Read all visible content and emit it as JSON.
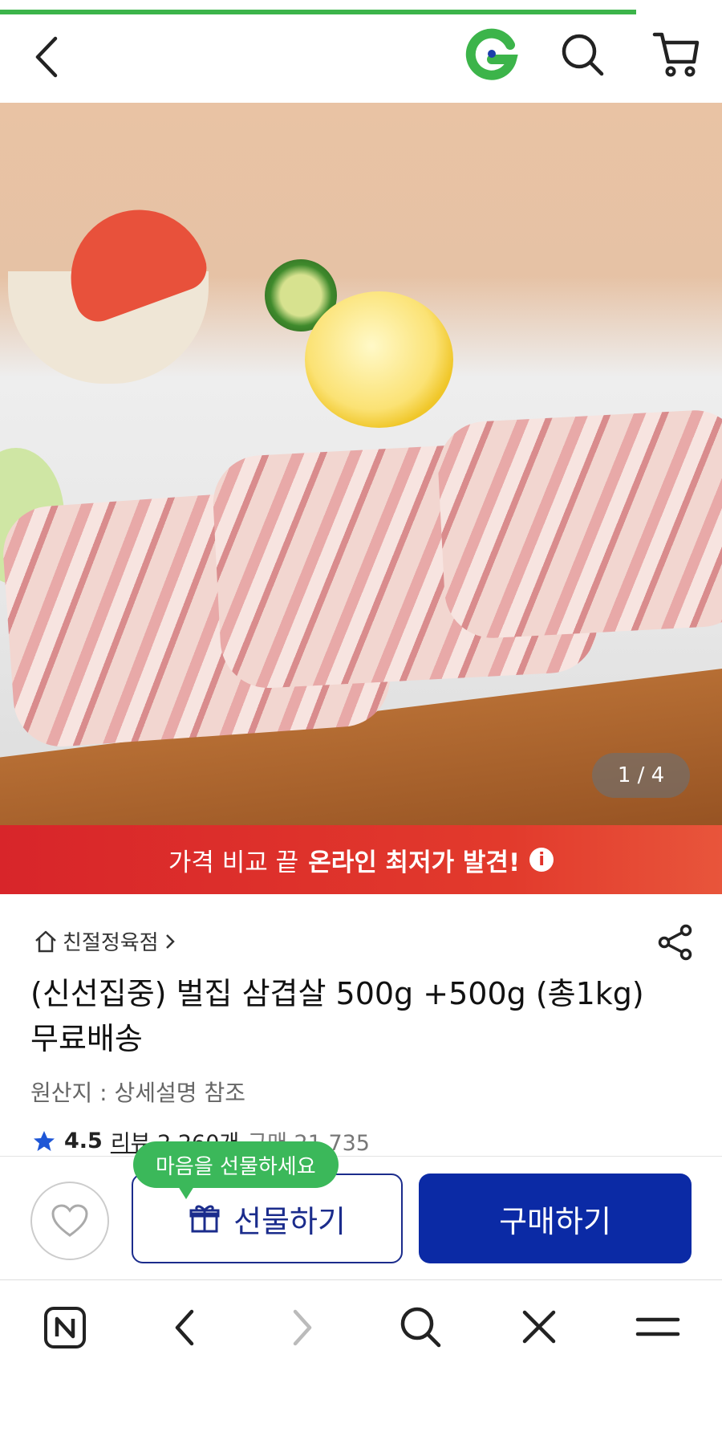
{
  "colors": {
    "progress": "#3cb44a",
    "brand_green": "#3cb44a",
    "buy_blue": "#0b2aa5",
    "banner_red": "#d8252a"
  },
  "header": {
    "logo_letter": "G",
    "icons": [
      "back-icon",
      "g-logo",
      "search-icon",
      "cart-icon"
    ]
  },
  "gallery": {
    "counter": "1 / 4"
  },
  "banner": {
    "text": "가격 비교 끝",
    "strong": "온라인 최저가 발견!",
    "info_icon": "i"
  },
  "product": {
    "store": "친절정육점",
    "title": "(신선집중) 벌집 삼겹살 500g +500g (총1kg) 무료배송",
    "origin": "원산지 : 상세설명 참조",
    "rating": "4.5",
    "reviews": "리뷰 2,260개",
    "purchases": "구매 21,735"
  },
  "actions": {
    "tooltip": "마음을 선물하세요",
    "gift": "선물하기",
    "buy": "구매하기"
  },
  "browser_nav": {
    "icons": [
      "naver-n-icon",
      "back-icon",
      "forward-icon",
      "search-icon",
      "close-icon",
      "menu-icon"
    ]
  }
}
